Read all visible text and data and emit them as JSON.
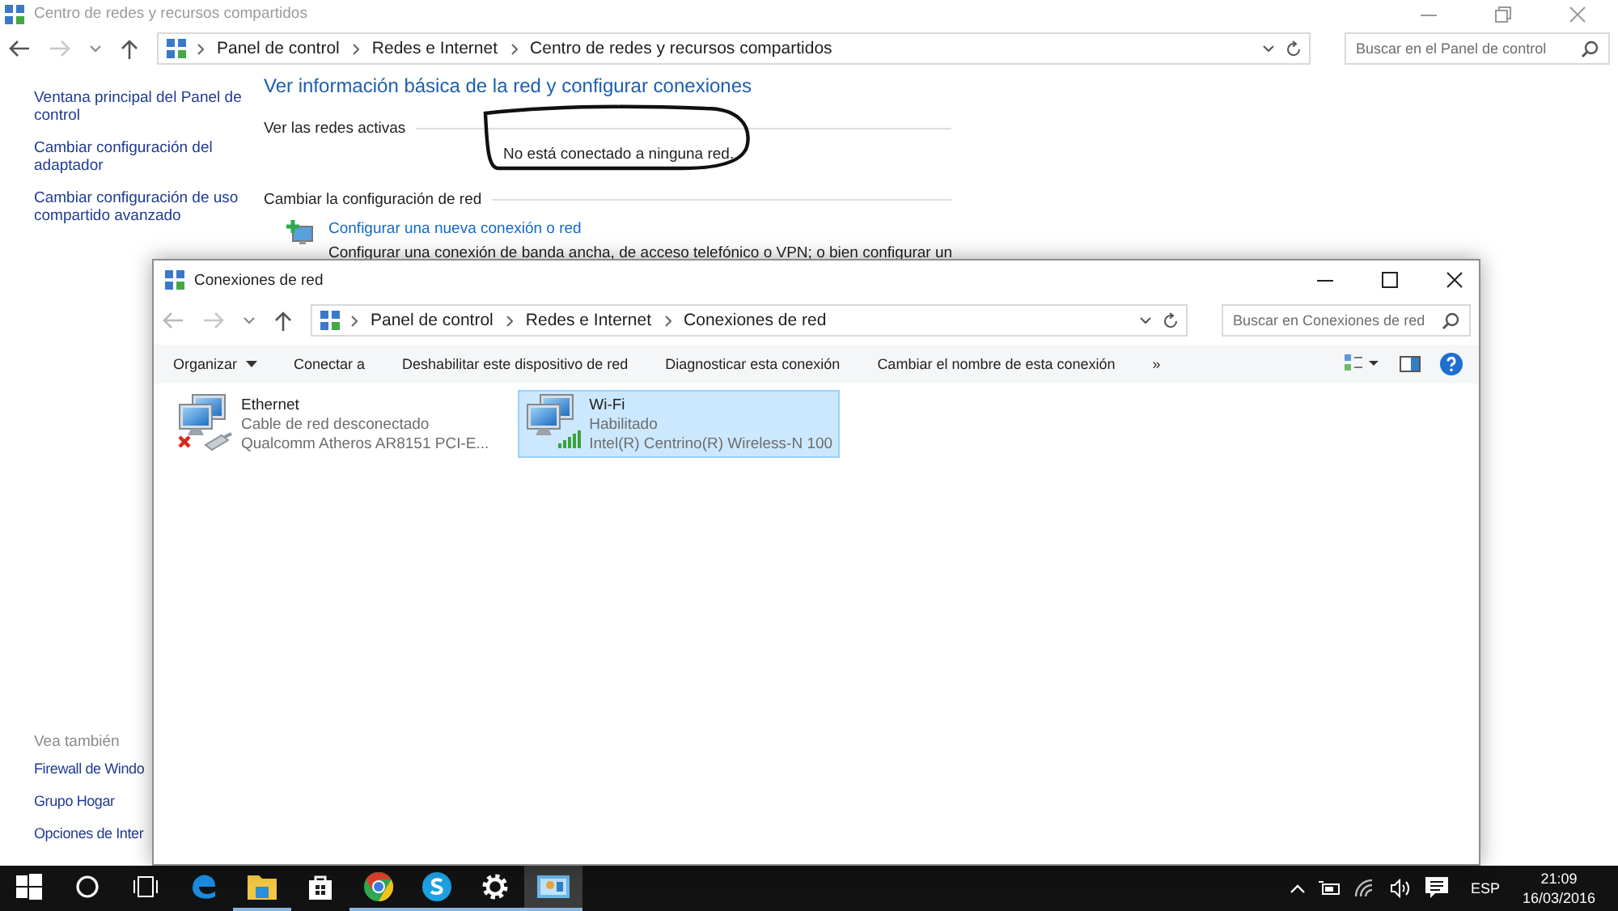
{
  "back_window": {
    "title": "Centro de redes y recursos compartidos",
    "breadcrumb": [
      "Panel de control",
      "Redes e Internet",
      "Centro de redes y recursos compartidos"
    ],
    "search": {
      "placeholder": "Buscar en el Panel de control"
    },
    "sidebar": {
      "links": [
        "Ventana principal del Panel de control",
        "Cambiar configuración del adaptador",
        "Cambiar configuración de uso compartido avanzado"
      ],
      "see_also_heading": "Vea también",
      "see_also": [
        "Firewall de Windo",
        "Grupo Hogar",
        "Opciones de Inter"
      ]
    },
    "heading": "Ver información básica de la red y configurar conexiones",
    "active_networks": {
      "label": "Ver las redes activas",
      "status": "No está conectado a ninguna red."
    },
    "change_settings": {
      "label": "Cambiar la configuración de red",
      "tasks": [
        {
          "link": "Configurar una nueva conexión o red",
          "description": "Configurar una conexión de banda ancha, de acceso telefónico o VPN; o bien configurar un"
        }
      ]
    }
  },
  "front_window": {
    "title": "Conexiones de red",
    "breadcrumb": [
      "Panel de control",
      "Redes e Internet",
      "Conexiones de red"
    ],
    "search": {
      "placeholder": "Buscar en Conexiones de red"
    },
    "commands": [
      {
        "label": "Organizar",
        "kind": "menu"
      },
      {
        "label": "Conectar a",
        "kind": "button"
      },
      {
        "label": "Deshabilitar este dispositivo de red",
        "kind": "button"
      },
      {
        "label": "Diagnosticar esta conexión",
        "kind": "button"
      },
      {
        "label": "Cambiar el nombre de esta conexión",
        "kind": "button"
      },
      {
        "label": "»",
        "kind": "overflow"
      }
    ],
    "connections": [
      {
        "name": "Ethernet",
        "status": "Cable de red desconectado",
        "adapter": "Qualcomm Atheros AR8151 PCI-E...",
        "kind": "wired",
        "disconnected": true,
        "selected": false
      },
      {
        "name": "Wi-Fi",
        "status": "Habilitado",
        "adapter": "Intel(R) Centrino(R) Wireless-N 100",
        "kind": "wireless",
        "disconnected": false,
        "selected": true
      }
    ]
  },
  "taskbar": {
    "apps": [
      {
        "kind": "start",
        "running": false,
        "selected": false
      },
      {
        "kind": "search",
        "running": false,
        "selected": false
      },
      {
        "kind": "taskview",
        "running": false,
        "selected": false
      },
      {
        "kind": "edge",
        "running": false,
        "selected": false
      },
      {
        "kind": "explorer",
        "running": true,
        "selected": false
      },
      {
        "kind": "store",
        "running": false,
        "selected": false
      },
      {
        "kind": "chrome",
        "running": true,
        "selected": false
      },
      {
        "kind": "skype",
        "running": true,
        "selected": false
      },
      {
        "kind": "settings",
        "running": true,
        "selected": false
      },
      {
        "kind": "control-panel",
        "running": true,
        "selected": true
      }
    ],
    "language": "ESP",
    "time": "21:09",
    "date": "16/03/2016"
  }
}
